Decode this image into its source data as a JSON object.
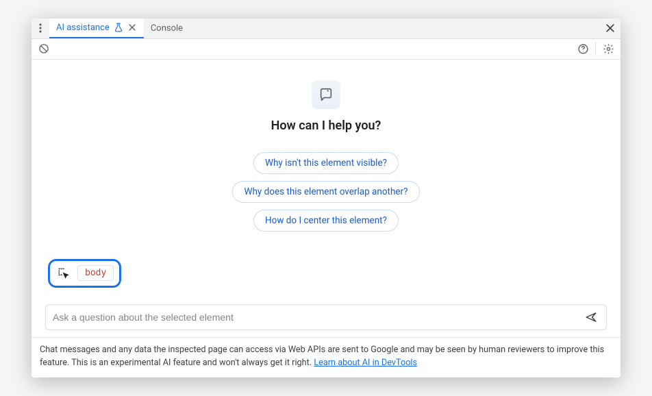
{
  "tabs": {
    "ai": "AI assistance",
    "console": "Console"
  },
  "heading": "How can I help you?",
  "suggestions": [
    "Why isn't this element visible?",
    "Why does this element overlap another?",
    "How do I center this element?"
  ],
  "context": {
    "selected_element": "body"
  },
  "input": {
    "placeholder": "Ask a question about the selected element"
  },
  "disclaimer": {
    "text": "Chat messages and any data the inspected page can access via Web APIs are sent to Google and may be seen by human reviewers to improve this feature. This is an experimental AI feature and won't always get it right. ",
    "link": "Learn about AI in DevTools"
  }
}
